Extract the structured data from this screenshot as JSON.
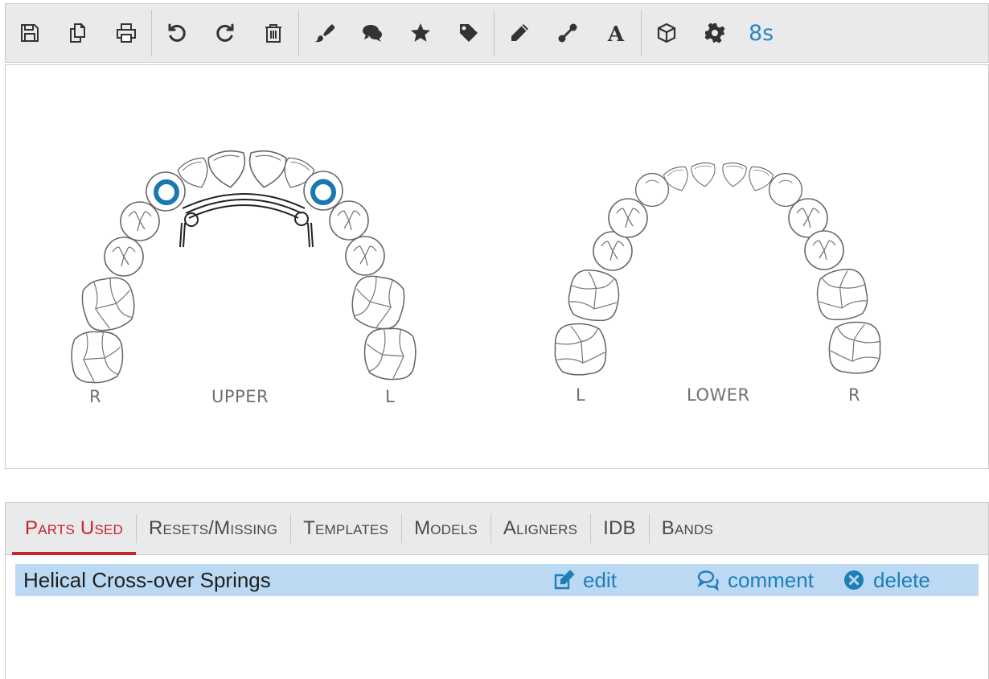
{
  "toolbar": {
    "buttons": [
      {
        "icon": "save-icon"
      },
      {
        "icon": "copy-icon"
      },
      {
        "icon": "print-icon"
      },
      {
        "icon": "undo-icon"
      },
      {
        "icon": "redo-icon"
      },
      {
        "icon": "trash-icon"
      },
      {
        "icon": "paintbrush-icon"
      },
      {
        "icon": "comments-icon"
      },
      {
        "icon": "star-icon"
      },
      {
        "icon": "tag-icon"
      },
      {
        "icon": "pencil-icon"
      },
      {
        "icon": "wire-icon"
      },
      {
        "icon": "text-icon"
      },
      {
        "icon": "cube-icon"
      },
      {
        "icon": "gear-icon"
      }
    ],
    "status": "8s",
    "icon_color": "#333333",
    "status_color": "#2a86c0"
  },
  "canvas": {
    "upper": {
      "label": "UPPER",
      "side_left": "R",
      "side_right": "L"
    },
    "lower": {
      "label": "LOWER",
      "side_left": "L",
      "side_right": "R"
    },
    "band_color": "#1a78b0"
  },
  "tabs": [
    {
      "label": "Parts Used",
      "active": true
    },
    {
      "label": "Resets/Missing",
      "active": false
    },
    {
      "label": "Templates",
      "active": false
    },
    {
      "label": "Models",
      "active": false
    },
    {
      "label": "Aligners",
      "active": false
    },
    {
      "label": "IDB",
      "active": false
    },
    {
      "label": "Bands",
      "active": false
    }
  ],
  "parts": [
    {
      "name": "Helical Cross-over Springs",
      "edit": "edit",
      "comment": "comment",
      "delete": "delete"
    }
  ],
  "colors": {
    "active_tab": "#c8232c",
    "row_highlight": "#bcd9f3",
    "link": "#1e7fb8"
  }
}
